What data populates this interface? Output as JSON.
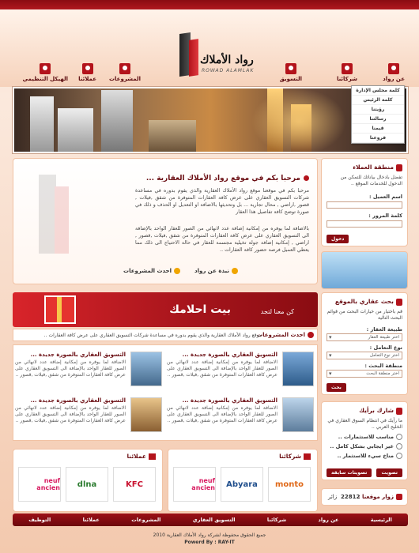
{
  "header": {
    "brand_ar": "رواد الأملاك",
    "brand_en": "ROWAD ALAMLAK",
    "nav": [
      "عن رواد",
      "شركائنا",
      "التسويق",
      "المشروعات",
      "عملائنا",
      "الهيكل التنظيمي"
    ]
  },
  "side_menu": [
    "كلمة مجلس الإدارة",
    "كلمة الرئيس",
    "رؤيتنا",
    "رسالتنا",
    "قيمنا",
    "فروعنا"
  ],
  "welcome": {
    "title": "مرحبا بكم في موقع رواد الأملاك العقارية ...",
    "p1": "مرحبا بكم في موقعنا موقع رواد الأملاك العقارية والذي يقوم بدوره في مساعدة شركات التسويق العقاري على عرض كافة العقارات المتوفرة من شقق ,فيلات , قصور ,اراضي , محال تجارية ... بل وتحديثها بالاضافة او التعديل او الحذف و ذلك في صورة توضح كافة تفاصيل هذا العقار",
    "p2": "بالاضافة لما يوفره من إمكانية إضافة عدد لانهائي من الصور للعقار الواحد بالإضافة الى التسويق العقاري على عرض كافة العقارات المتوفرة من شقق ,فيلات ,قصور , اراضي , إمكانية إضافة جولة تخيلية مجسمة للعقار في حالة الاحتياج الى ذلك مما يعطي العميل فرصة حضور كافة العقارات ..",
    "link1": "نبذة عن رواد",
    "link2": "احدث المشروعات"
  },
  "promo": {
    "line1": "بيت احلامك",
    "line2_prefix": "كن معنا لتجد"
  },
  "news": {
    "title": "احدث المشروعات",
    "text": "موقع رواد الأملاك العقارية والذي يقوم بدوره في مساعدة شركات التسويق العقاري على عرض كافة العقارات .."
  },
  "items": [
    {
      "title": "التسويق العقاري بالصورة جديدة ...",
      "text": "الاضافة لما يوفره من إمكانية إضافة عدد لانهائي من الصور للعقار الواحد بالإضافة الى التسويق العقاري على عرض كافة العقارات المتوفرة من شقق ,فيلات ,قصور .."
    },
    {
      "title": "التسويق العقاري بالصورة جديدة ...",
      "text": "الاضافة لما يوفره من إمكانية إضافة عدد لانهائي من الصور للعقار الواحد بالإضافة الى التسويق العقاري على عرض كافة العقارات المتوفرة من شقق ,فيلات ,قصور .."
    },
    {
      "title": "التسويق العقاري بالصورة جديدة ...",
      "text": "الاضافة لما يوفره من إمكانية إضافة عدد لانهائي من الصور للعقار الواحد بالإضافة الى التسويق العقاري على عرض كافة العقارات المتوفرة من شقق ,فيلات ,قصور .."
    },
    {
      "title": "التسويق العقاري بالصورة جديدة ...",
      "text": "الاضافة لما يوفره من إمكانية إضافة عدد لانهائي من الصور للعقار الواحد بالإضافة الى التسويق العقاري على عرض كافة العقارات المتوفرة من شقق ,فيلات ,قصور .."
    }
  ],
  "partners": {
    "title": "شركائنا",
    "logos": [
      "monto",
      "Abyara",
      "neuf ancien"
    ]
  },
  "clients": {
    "title": "عملائنا",
    "logos": [
      "KFC",
      "dlna",
      "neuf ancien"
    ]
  },
  "login": {
    "title": "منطقة العملاء",
    "hint": "تفضل بادخال بياناتك للتمكن من الدخول للخدمات الموقع ..",
    "user_label": "اسم العميل :",
    "pass_label": "كلمة المرور :",
    "button": "دخول"
  },
  "search": {
    "title": "بحث عقاري بالموقع",
    "hint": "قم باختيار من خيارات البحث من قوائم البحث التالية",
    "f1_label": "طبيعة العقار :",
    "f1_value": "اختر طبيعة العقار",
    "f2_label": "نوع التعامل :",
    "f2_value": "اختر نوع التعامل",
    "f3_label": "منطقة البحث :",
    "f3_value": "اختر منطقة البحث",
    "button": "بحث"
  },
  "poll": {
    "title": "شارك برأيك",
    "question": "ما رأيك في انتظام السوق العقاري في الخليج العربي ..",
    "options": [
      "مناسب للاستثمارات ..",
      "غير ايجابي بشكل كامل ..",
      "مناخ سيء للاستثمار .."
    ],
    "vote_button": "تصويت",
    "prev_button": "تصويتات سابقة"
  },
  "visitors": {
    "label": "زوار موقعنا :",
    "count": "22812",
    "unit": "زائر"
  },
  "footer": {
    "nav": [
      "الرئيسية",
      "عن رواد",
      "شركائنا",
      "التسويق العقاري",
      "المشروعات",
      "عملائنا",
      "التوظيف"
    ],
    "copyright": "جميع الحقوق محفوظة لشركة رواد الأملاك العقارية 2010",
    "powered": "Powerd By : RAY-IT"
  },
  "colors": {
    "accent": "#b3131b",
    "dark": "#6a0d12"
  }
}
